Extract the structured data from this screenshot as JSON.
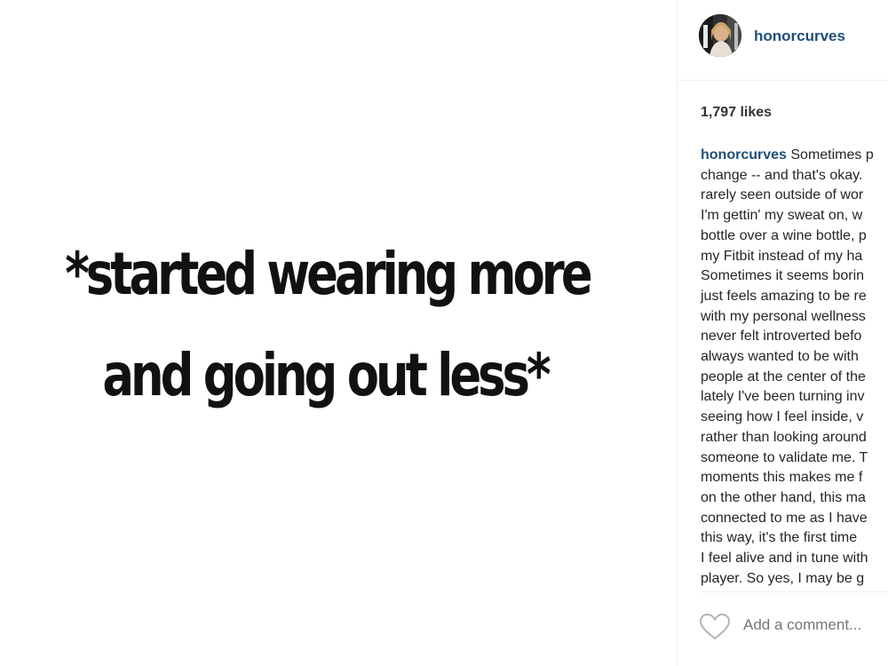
{
  "post": {
    "quote_lines": [
      "*started wearing more",
      "and going out less*"
    ]
  },
  "sidebar": {
    "username": "honorcurves",
    "likes": "1,797 likes",
    "caption": {
      "username": "honorcurves",
      "lines": [
        "Sometimes p",
        "change -- and that's okay.",
        "rarely seen outside of wor",
        "I'm gettin' my sweat on, w",
        "bottle over a wine bottle, p",
        "my Fitbit instead of my ha",
        "Sometimes it seems borin",
        "just feels amazing to be re",
        "with my personal wellness",
        "never felt introverted befo",
        "always wanted to be with",
        "people at the center of the",
        "lately I've been turning inv",
        "seeing how I feel inside, v",
        "rather than looking around",
        "someone to validate me. T",
        "moments this makes me f",
        "on the other hand, this ma",
        "connected to me as I have",
        "this way, it's the first time",
        "I feel alive and in tune with",
        "player. So yes, I may be g"
      ]
    },
    "comment_placeholder": "Add a comment..."
  },
  "icons": {
    "avatar": "avatar-photo",
    "like": "heart-outline-icon"
  },
  "colors": {
    "username": "#1f4f7a",
    "text": "#262626",
    "placeholder": "#9a9a9a",
    "divider": "#efefef"
  }
}
